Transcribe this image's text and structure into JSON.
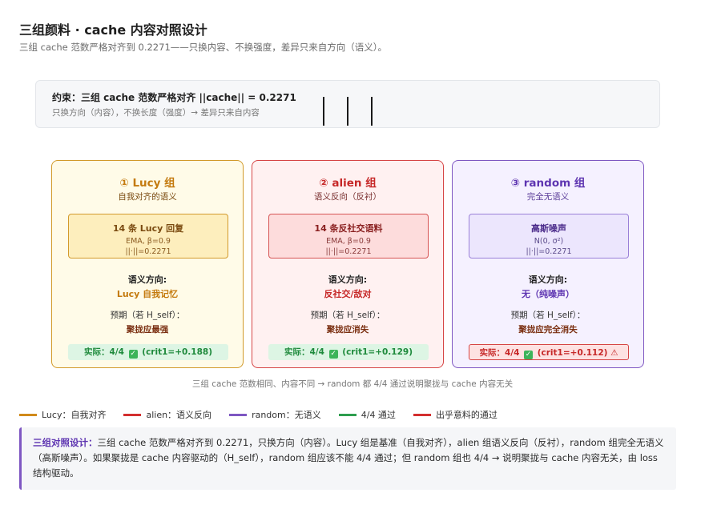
{
  "header": {
    "title": "三组颜料 · cache 内容对照设计",
    "subtitle": "三组 cache 范数严格对齐到 0.2271——只换内容、不换强度，差异只来自方向（语义）。"
  },
  "constraint": {
    "title": "约束：三组 cache 范数严格对齐 ||cache|| = 0.2271",
    "desc": "只换方向（内容），不换长度（强度）→ 差异只来自内容"
  },
  "cards": {
    "lucy": {
      "name": "① Lucy 组",
      "sub": "自我对齐的语义",
      "inner_title": "14 条 Lucy 回复",
      "inner_l1": "EMA, β=0.9",
      "inner_l2": "||·||=0.2271",
      "dir_label": "语义方向:",
      "dir_value": "Lucy 自我记忆",
      "pred_label": "预期（若 H_self）：",
      "pred_value": "聚拢应最强",
      "result_prefix": "实际：4/4",
      "result_suffix": "(crit1=+0.188)",
      "result_icon": "✓"
    },
    "alien": {
      "name": "② alien 组",
      "sub": "语义反向（反衬）",
      "inner_title": "14 条反社交语料",
      "inner_l1": "EMA, β=0.9",
      "inner_l2": "||·||=0.2271",
      "dir_label": "语义方向:",
      "dir_value": "反社交/敌对",
      "pred_label": "预期（若 H_self）：",
      "pred_value": "聚拢应消失",
      "result_prefix": "实际：4/4",
      "result_suffix": "(crit1=+0.129)",
      "result_icon": "✓"
    },
    "random": {
      "name": "③ random 组",
      "sub": "完全无语义",
      "inner_title": "高斯噪声",
      "inner_l1": "N(0, σ²)",
      "inner_l2": "||·||=0.2271",
      "dir_label": "语义方向:",
      "dir_value": "无（纯噪声）",
      "pred_label": "预期（若 H_self）：",
      "pred_value": "聚拢应完全消失",
      "result_prefix": "实际：4/4",
      "result_suffix": "(crit1=+0.112) ⚠",
      "result_icon": "✓"
    }
  },
  "caption": "三组 cache 范数相同、内容不同 → random 都 4/4 通过说明聚拢与 cache 内容无关",
  "legend": [
    {
      "label": "Lucy：自我对齐",
      "color": "#d08a1a"
    },
    {
      "label": "alien：语义反向",
      "color": "#d32f2f"
    },
    {
      "label": "random：无语义",
      "color": "#7e57c2"
    },
    {
      "label": "4/4 通过",
      "color": "#2e9e4f"
    },
    {
      "label": "出乎意料的通过",
      "color": "#d32f2f"
    }
  ],
  "note": {
    "head": "三组对照设计：",
    "body": "三组 cache 范数严格对齐到 0.2271，只换方向（内容）。Lucy 组是基准（自我对齐），alien 组语义反向（反衬），random 组完全无语义（高斯噪声）。如果聚拢是 cache 内容驱动的（H_self），random 组应该不能 4/4 通过；但 random 组也 4/4 → 说明聚拢与 cache 内容无关，由 loss 结构驱动。"
  },
  "colors": {
    "lucy": "#d29a2a",
    "alien": "#d64545",
    "random": "#7e57c2",
    "pass": "#2e9e4f"
  }
}
